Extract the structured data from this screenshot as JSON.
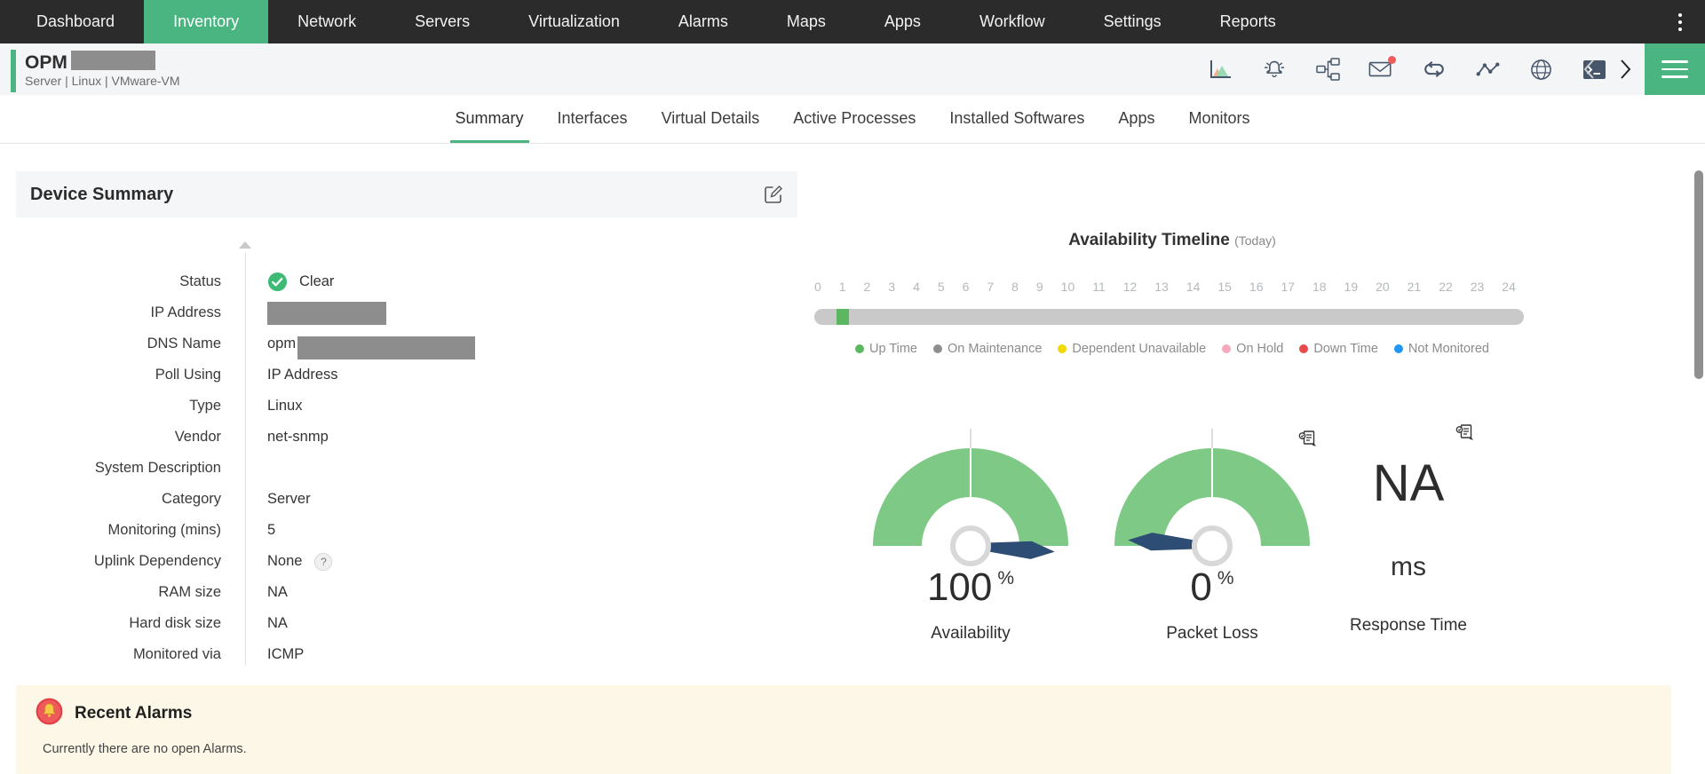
{
  "colors": {
    "accent_green": "#4bb582",
    "nav_bg": "#2b2b2b",
    "gauge_green": "#7dc985",
    "needle_navy": "#2e4d74",
    "status_clear_green": "#3dba73",
    "alarm_panel_bg": "#fcf7e6",
    "alarm_badge_red": "#ef5154"
  },
  "nav": {
    "items": [
      {
        "label": "Dashboard",
        "active": false
      },
      {
        "label": "Inventory",
        "active": true
      },
      {
        "label": "Network",
        "active": false
      },
      {
        "label": "Servers",
        "active": false
      },
      {
        "label": "Virtualization",
        "active": false
      },
      {
        "label": "Alarms",
        "active": false
      },
      {
        "label": "Maps",
        "active": false
      },
      {
        "label": "Apps",
        "active": false
      },
      {
        "label": "Workflow",
        "active": false
      },
      {
        "label": "Settings",
        "active": false
      },
      {
        "label": "Reports",
        "active": false
      }
    ]
  },
  "device_header": {
    "title": "OPM",
    "subtitle": "Server | Linux  | VMware-VM",
    "icons": [
      "performance-chart",
      "alarm-bell",
      "workflow",
      "mail",
      "loop",
      "sparkline",
      "web",
      "terminal",
      "previous-device",
      "next-device",
      "menu"
    ]
  },
  "tabs": [
    {
      "label": "Summary",
      "active": true
    },
    {
      "label": "Interfaces",
      "active": false
    },
    {
      "label": "Virtual Details",
      "active": false
    },
    {
      "label": "Active Processes",
      "active": false
    },
    {
      "label": "Installed Softwares",
      "active": false
    },
    {
      "label": "Apps",
      "active": false
    },
    {
      "label": "Monitors",
      "active": false
    }
  ],
  "device_summary": {
    "title": "Device Summary",
    "fields": [
      {
        "label": "Status",
        "value": "Clear",
        "type": "status"
      },
      {
        "label": "IP Address",
        "value": "",
        "type": "redacted"
      },
      {
        "label": "DNS Name",
        "value": "opm",
        "type": "text_redacted"
      },
      {
        "label": "Poll Using",
        "value": "IP Address",
        "type": "text"
      },
      {
        "label": "Type",
        "value": "Linux",
        "type": "text"
      },
      {
        "label": "Vendor",
        "value": "net-snmp",
        "type": "text"
      },
      {
        "label": "System Description",
        "value": "",
        "type": "text"
      },
      {
        "label": "Category",
        "value": "Server",
        "type": "text"
      },
      {
        "label": "Monitoring (mins)",
        "value": "5",
        "type": "text"
      },
      {
        "label": "Uplink Dependency",
        "value": "None",
        "type": "help"
      },
      {
        "label": "RAM size",
        "value": "NA",
        "type": "text"
      },
      {
        "label": "Hard disk size",
        "value": "NA",
        "type": "text"
      },
      {
        "label": "Monitored via",
        "value": "ICMP",
        "type": "text"
      }
    ]
  },
  "availability_timeline": {
    "title": "Availability Timeline",
    "period": "(Today)",
    "ticks": [
      "0",
      "1",
      "2",
      "3",
      "4",
      "5",
      "6",
      "7",
      "8",
      "9",
      "10",
      "11",
      "12",
      "13",
      "14",
      "15",
      "16",
      "17",
      "18",
      "19",
      "20",
      "21",
      "22",
      "23",
      "24"
    ],
    "bar": {
      "track_color": "#c9c9c9",
      "segments": [
        {
          "label": "Up Time",
          "color": "#5cb860",
          "offset_pct": 3.1,
          "width_pct": 1.8
        }
      ]
    },
    "legend": [
      {
        "label": "Up Time",
        "color": "#5cb860"
      },
      {
        "label": "On Maintenance",
        "color": "#8e8e8e"
      },
      {
        "label": "Dependent Unavailable",
        "color": "#f0d800"
      },
      {
        "label": "On Hold",
        "color": "#f8a8bc"
      },
      {
        "label": "Down Time",
        "color": "#e94b4b"
      },
      {
        "label": "Not Monitored",
        "color": "#2196f3"
      }
    ]
  },
  "gauges": [
    {
      "value": "100",
      "unit": "%",
      "label": "Availability"
    },
    {
      "value": "0",
      "unit": "%",
      "label": "Packet Loss"
    },
    {
      "value": "NA",
      "unit": "ms",
      "label": "Response Time"
    }
  ],
  "recent_alarms": {
    "title": "Recent Alarms",
    "message": "Currently there are no open Alarms."
  }
}
